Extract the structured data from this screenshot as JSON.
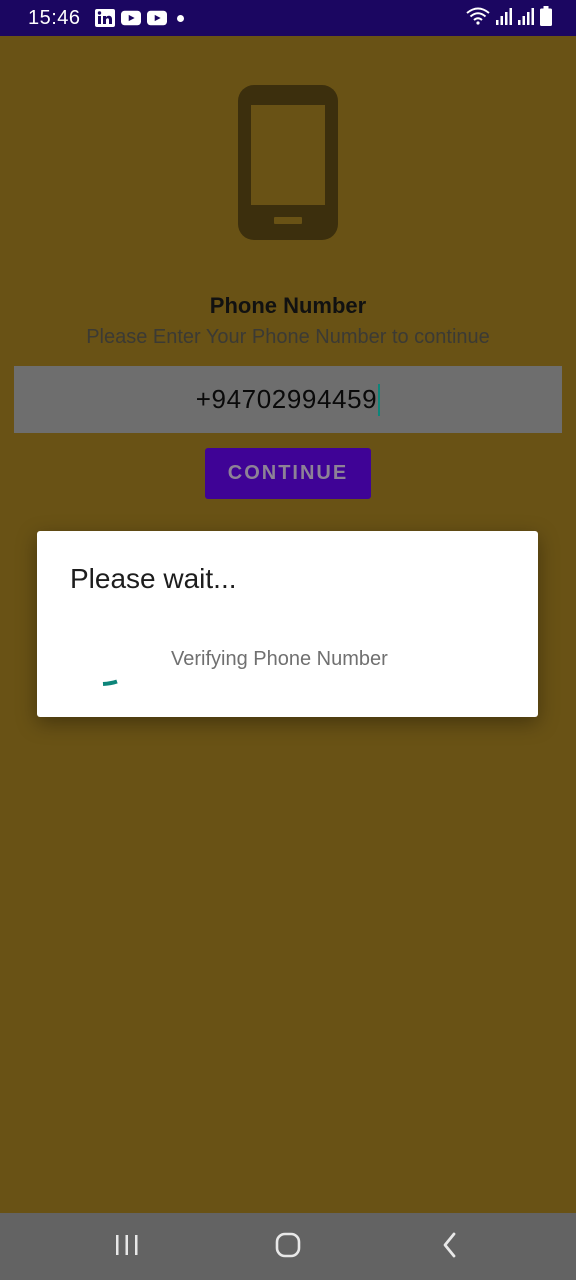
{
  "status_bar": {
    "time": "15:46",
    "notification_icons": [
      "linkedin-icon",
      "youtube-icon",
      "youtube-icon"
    ],
    "right_icons": [
      "wifi-icon",
      "signal-icon",
      "signal-icon",
      "battery-icon"
    ]
  },
  "screen": {
    "title": "Phone Number",
    "subtitle": "Please Enter Your Phone Number to continue",
    "phone_value": "+94702994459",
    "continue_label": "CONTINUE"
  },
  "dialog": {
    "title": "Please wait...",
    "message": "Verifying Phone Number"
  },
  "nav_bar": {
    "buttons": [
      "recents-icon",
      "home-icon",
      "back-icon"
    ]
  },
  "colors": {
    "background": "#695215",
    "status_bar": "#1b0661",
    "button": "#3f0396",
    "input": "#6e6e6e",
    "spinner": "#0d857a",
    "nav_bar": "#636363"
  }
}
